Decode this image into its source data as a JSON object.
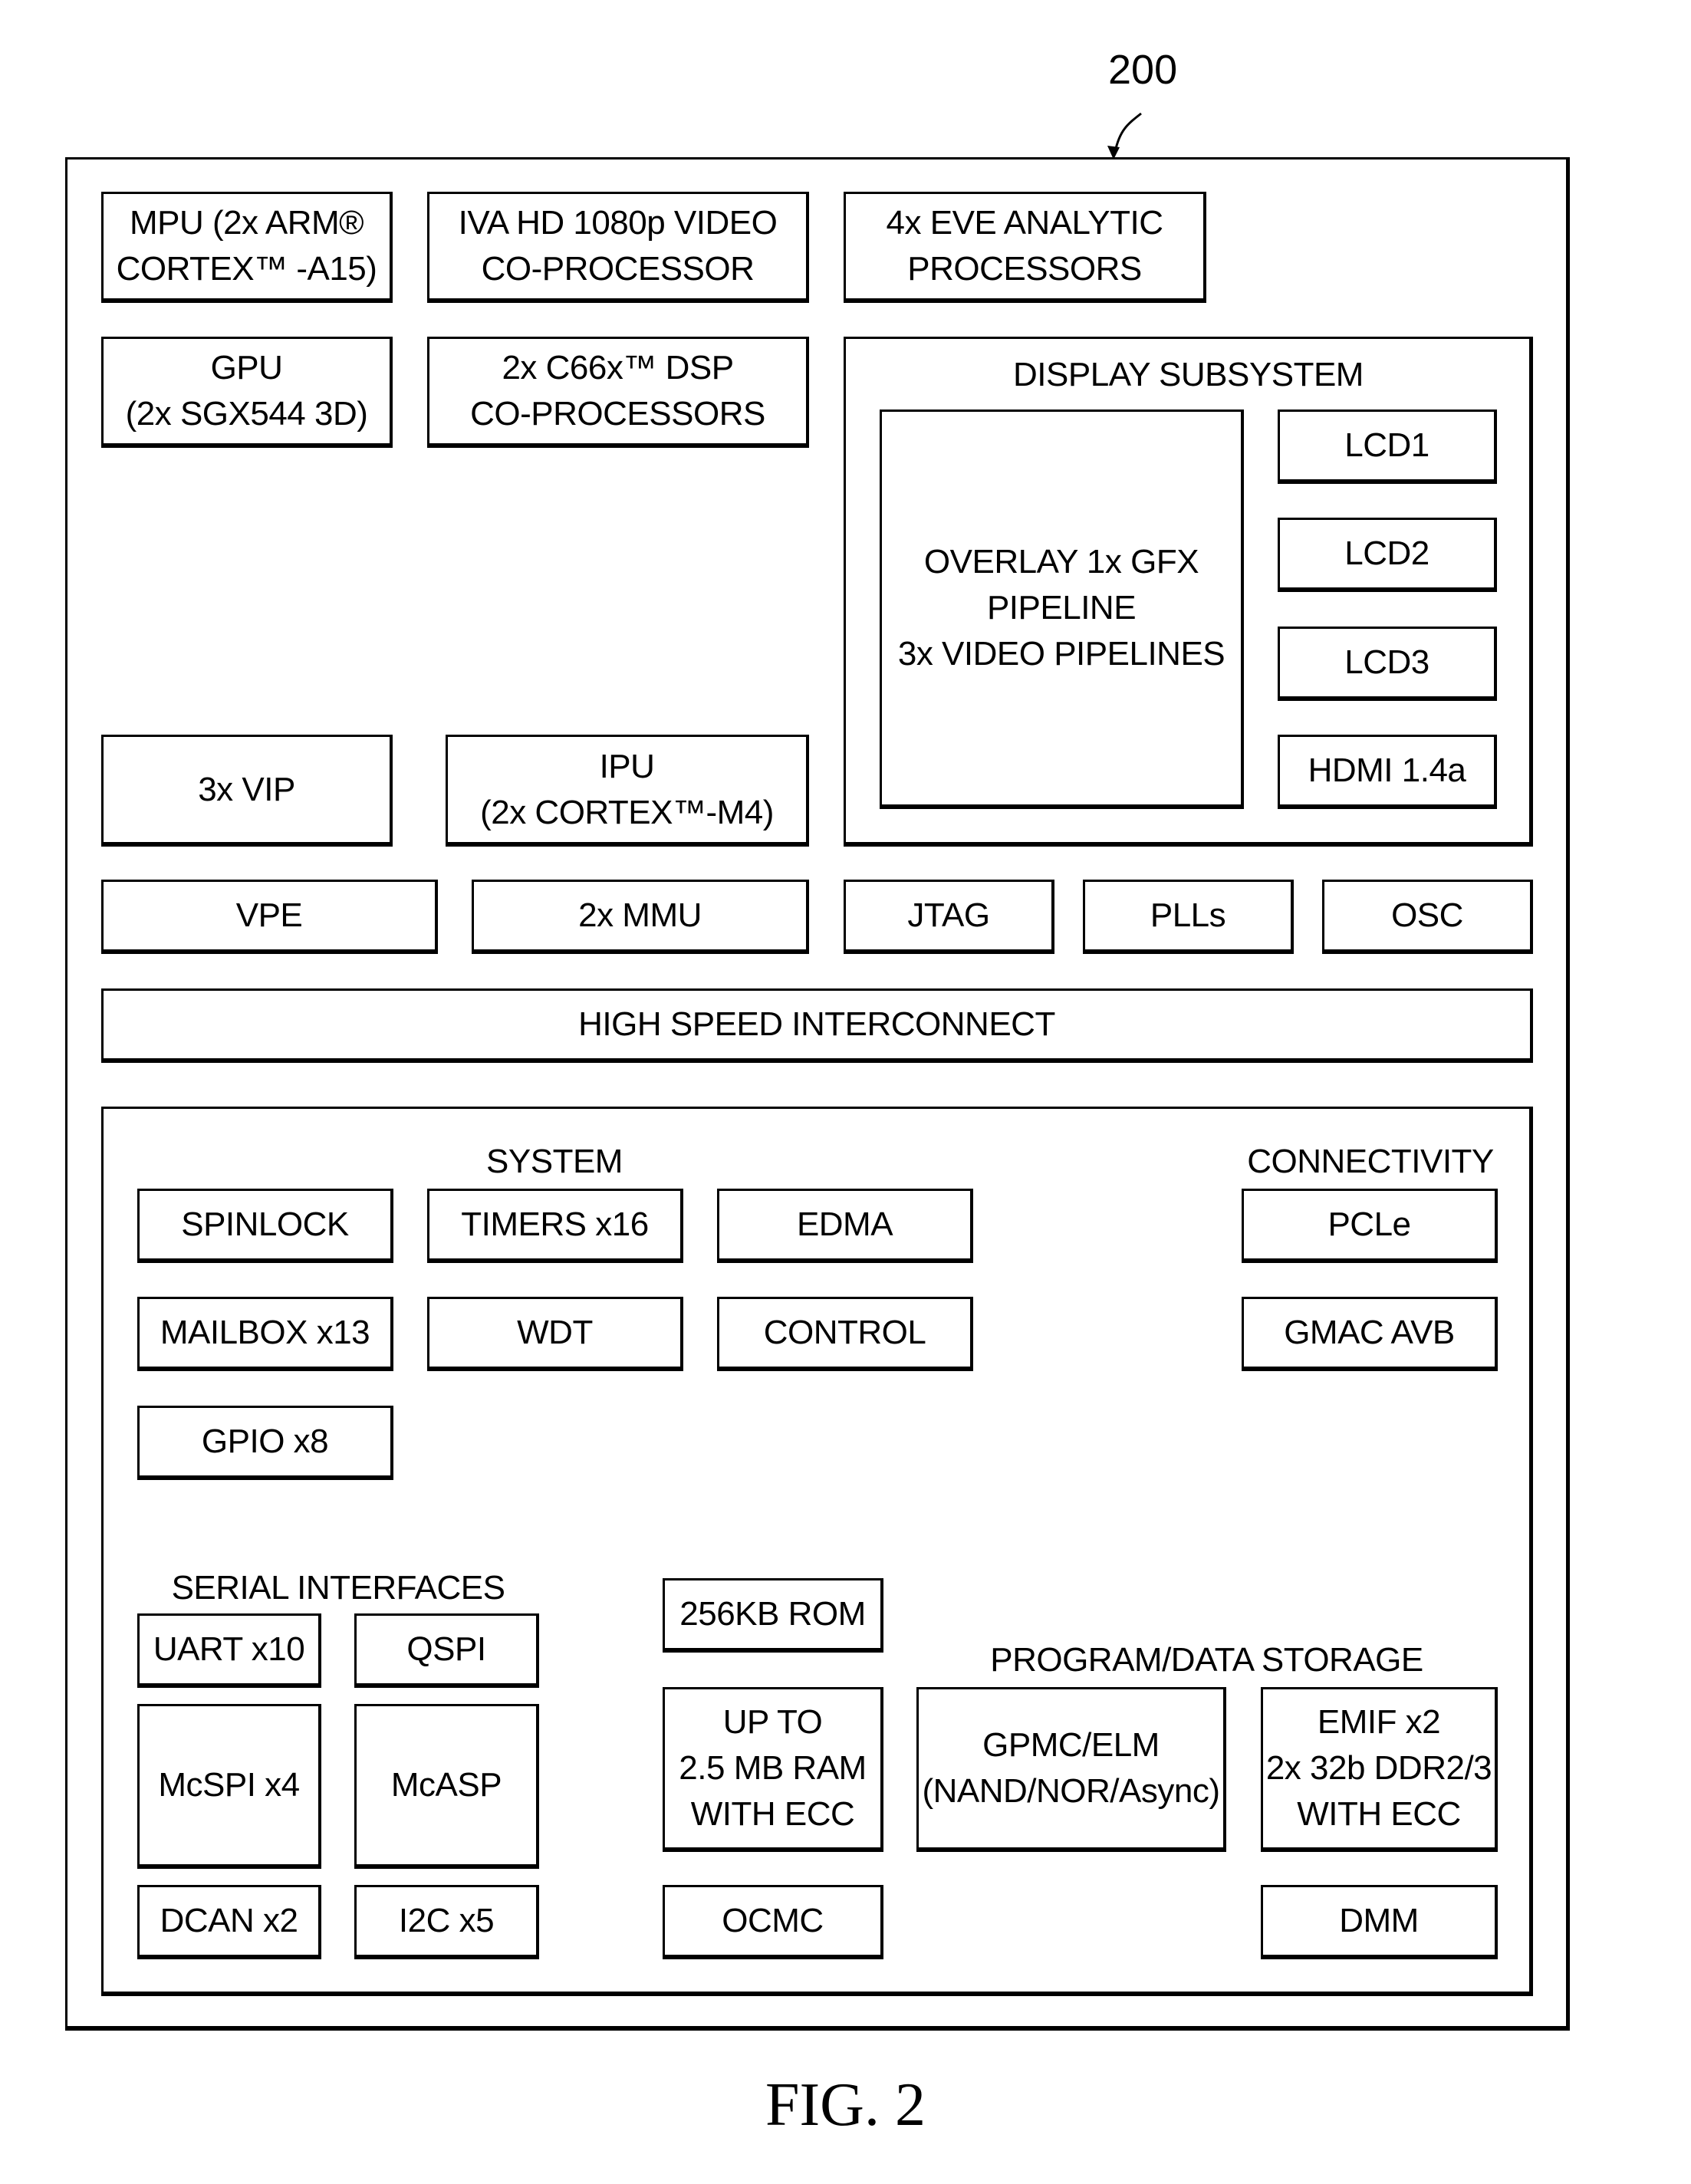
{
  "figure": {
    "reference_numeral": "200",
    "caption": "FIG. 2"
  },
  "top_blocks": {
    "mpu": "MPU (2x ARM®\nCORTEX™ -A15)",
    "iva": "IVA HD 1080p VIDEO\nCO-PROCESSOR",
    "eve": "4x EVE ANALYTIC\nPROCESSORS",
    "gpu": "GPU\n(2x SGX544 3D)",
    "dsp": "2x C66x™ DSP\nCO-PROCESSORS",
    "vip": "3x VIP",
    "ipu": "IPU\n(2x CORTEX™-M4)"
  },
  "display_subsystem": {
    "title": "DISPLAY SUBSYSTEM",
    "overlay": "OVERLAY 1x GFX\nPIPELINE\n3x VIDEO PIPELINES",
    "outputs": [
      "LCD1",
      "LCD2",
      "LCD3",
      "HDMI 1.4a"
    ]
  },
  "mid_row": [
    "VPE",
    "2x MMU",
    "JTAG",
    "PLLs",
    "OSC"
  ],
  "interconnect": "HIGH SPEED INTERCONNECT",
  "peripherals": {
    "system": {
      "title": "SYSTEM",
      "items": [
        "SPINLOCK",
        "TIMERS x16",
        "EDMA",
        "MAILBOX x13",
        "WDT",
        "CONTROL",
        "GPIO x8"
      ]
    },
    "connectivity": {
      "title": "CONNECTIVITY",
      "items": [
        "PCLe",
        "GMAC AVB"
      ]
    },
    "serial": {
      "title": "SERIAL INTERFACES",
      "items": [
        "UART x10",
        "QSPI",
        "McSPI x4",
        "McASP",
        "DCAN x2",
        "I2C x5"
      ]
    },
    "memory": {
      "rom": "256KB ROM",
      "ram": "UP TO\n2.5 MB RAM\nWITH ECC",
      "ocmc": "OCMC"
    },
    "storage": {
      "title": "PROGRAM/DATA STORAGE",
      "gpmc": "GPMC/ELM\n(NAND/NOR/Async)",
      "emif": "EMIF x2\n2x 32b DDR2/3\nWITH ECC",
      "dmm": "DMM"
    }
  }
}
